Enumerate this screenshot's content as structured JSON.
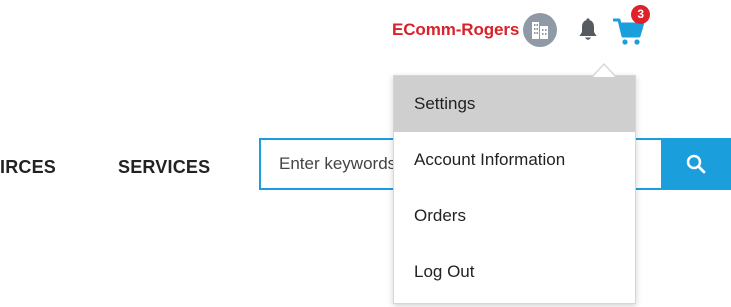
{
  "header": {
    "account_name": "EComm-Rogers",
    "avatar_icon": "building-icon",
    "notification_icon": "bell-icon",
    "cart_icon": "shopping-cart-icon",
    "cart_count": "3"
  },
  "nav": {
    "items": [
      {
        "label": "IRCES"
      },
      {
        "label": "SERVICES"
      }
    ]
  },
  "search": {
    "placeholder": "Enter keywords",
    "button_icon": "search-icon"
  },
  "account_menu": {
    "items": [
      {
        "label": "Settings",
        "highlighted": true
      },
      {
        "label": "Account Information",
        "highlighted": false
      },
      {
        "label": "Orders",
        "highlighted": false
      },
      {
        "label": "Log Out",
        "highlighted": false
      }
    ]
  },
  "colors": {
    "accent": "#1a9fdc",
    "brand_red": "#d6232b",
    "badge_red": "#e0202a",
    "menu_highlight": "#cfcfcf"
  }
}
